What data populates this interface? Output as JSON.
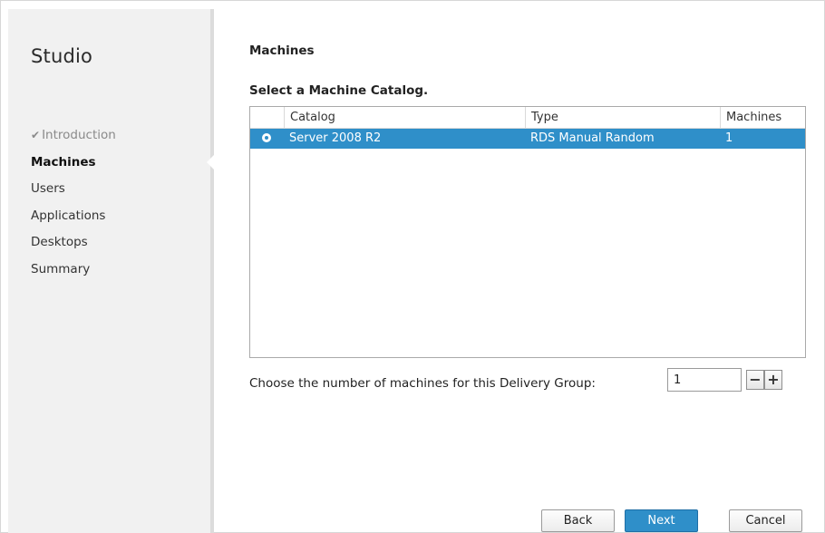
{
  "app": {
    "title": "Studio"
  },
  "steps": [
    {
      "label": "Introduction",
      "state": "done"
    },
    {
      "label": "Machines",
      "state": "active"
    },
    {
      "label": "Users",
      "state": "pending"
    },
    {
      "label": "Applications",
      "state": "pending"
    },
    {
      "label": "Desktops",
      "state": "pending"
    },
    {
      "label": "Summary",
      "state": "pending"
    }
  ],
  "page": {
    "title": "Machines",
    "section_label": "Select a Machine Catalog."
  },
  "table": {
    "columns": [
      "Catalog",
      "Type",
      "Machines"
    ],
    "rows": [
      {
        "catalog": "Server 2008 R2",
        "type": "RDS Manual Random",
        "machines": "1",
        "selected": true
      }
    ]
  },
  "count": {
    "label": "Choose the number of machines for this Delivery Group:",
    "value": "1",
    "minus_label": "−",
    "plus_label": "+"
  },
  "buttons": {
    "back": "Back",
    "next": "Next",
    "cancel": "Cancel"
  },
  "colors": {
    "accent": "#2f8fc9",
    "sidebar_bg": "#f1f1f1"
  },
  "icons": {
    "done_step": "checkmark-icon",
    "selected_row": "radio-selected-icon"
  }
}
